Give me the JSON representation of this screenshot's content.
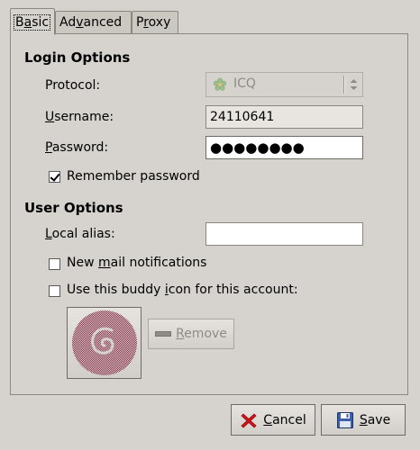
{
  "tabs": [
    {
      "label": "Basic",
      "active": true
    },
    {
      "label": "Advanced",
      "active": false
    },
    {
      "label": "Proxy",
      "active": false
    }
  ],
  "login_options": {
    "title": "Login Options",
    "protocol_label": "Protocol:",
    "protocol_value": "ICQ",
    "username_label": "Username:",
    "username_value": "24110641",
    "password_label": "Password:",
    "password_value": "●●●●●●●●",
    "remember_password_label": "Remember password",
    "remember_password_checked": true
  },
  "user_options": {
    "title": "User Options",
    "local_alias_label": "Local alias:",
    "local_alias_value": "",
    "new_mail_label": "New mail notifications",
    "new_mail_checked": false,
    "buddy_icon_label": "Use this buddy icon for this account:",
    "buddy_icon_checked": false,
    "remove_button_label": "Remove"
  },
  "footer": {
    "cancel_label": "Cancel",
    "save_label": "Save"
  },
  "colors": {
    "window_bg": "#d6d3ce",
    "debian_swirl": "#b0305a"
  }
}
